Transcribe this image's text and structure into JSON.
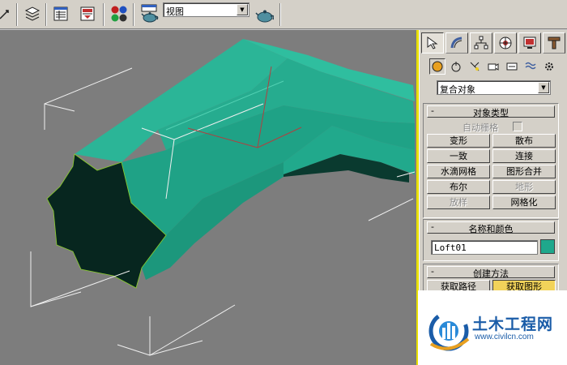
{
  "toolbar": {
    "view_select_value": "视图",
    "icons": [
      "pan-icon",
      "layers-icon",
      "schematic-view-icon",
      "curve-editor-icon",
      "material-editor-icon",
      "render-scene-icon",
      "quick-render-icon"
    ]
  },
  "command_panel": {
    "tabs": [
      "create-tab",
      "modify-tab",
      "hierarchy-tab",
      "motion-tab",
      "display-tab",
      "utilities-tab"
    ],
    "subcategories": [
      "geometry-icon",
      "shapes-icon",
      "lights-icon",
      "cameras-icon",
      "helpers-icon",
      "space-warps-icon",
      "systems-icon"
    ],
    "category_value": "复合对象",
    "object_type": {
      "title": "对象类型",
      "autogrid_label": "自动栅格",
      "buttons": [
        {
          "label": "变形",
          "enabled": true
        },
        {
          "label": "散布",
          "enabled": true
        },
        {
          "label": "一致",
          "enabled": true
        },
        {
          "label": "连接",
          "enabled": true
        },
        {
          "label": "水滴网格",
          "enabled": true
        },
        {
          "label": "图形合并",
          "enabled": true
        },
        {
          "label": "布尔",
          "enabled": true
        },
        {
          "label": "地形",
          "enabled": false
        },
        {
          "label": "放样",
          "enabled": false
        },
        {
          "label": "网格化",
          "enabled": true
        }
      ]
    },
    "name_color": {
      "title": "名称和颜色",
      "name_value": "Loft01",
      "color": "#1fa88c"
    },
    "creation_method": {
      "title": "创建方法",
      "get_path_label": "获取路径",
      "get_shape_label": "获取图形"
    },
    "rollout_minus": "-"
  },
  "colors": {
    "object_top": "#2bb597",
    "object_side": "#1d9b7f",
    "object_dark": "#07261f",
    "viewport_bg": "#7d7d7d",
    "active_border": "#e8e000"
  },
  "watermark": {
    "title": "土木工程网",
    "url": "www.civilcn.com"
  }
}
